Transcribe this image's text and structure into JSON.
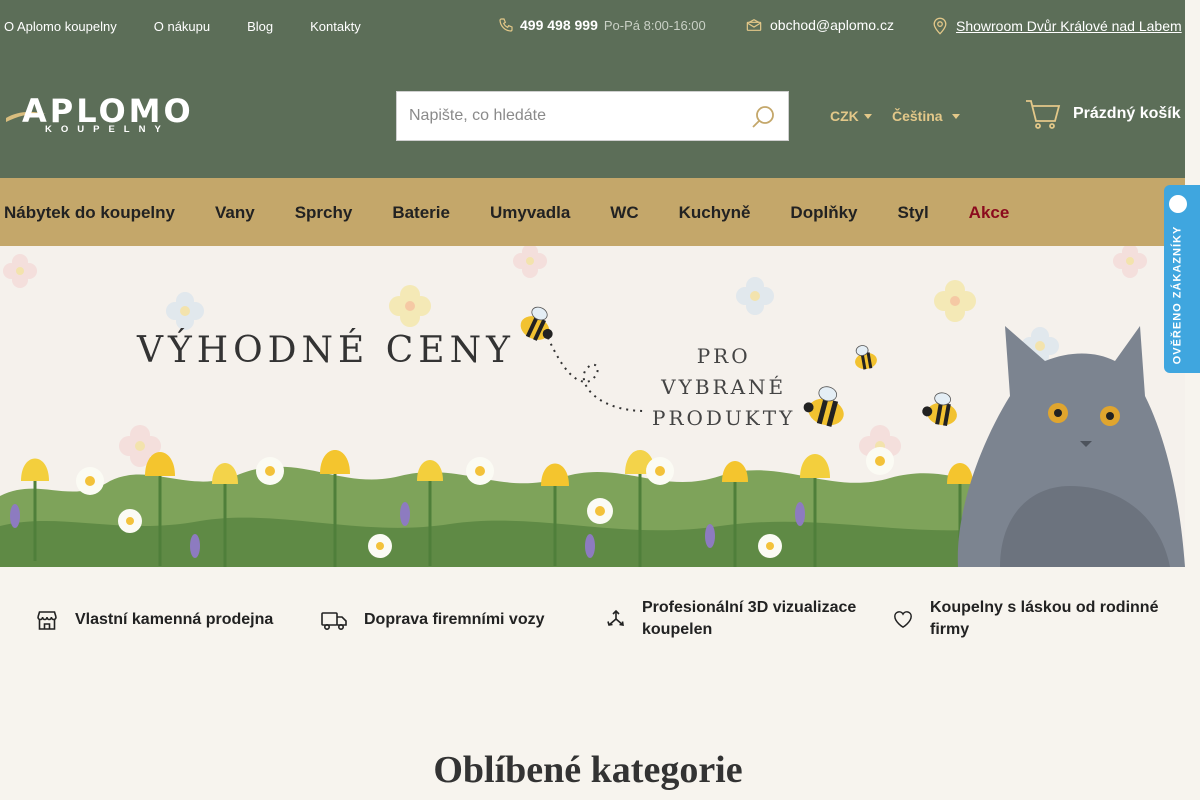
{
  "topbar": {
    "links": [
      "O Aplomo koupelny",
      "O nákupu",
      "Blog",
      "Kontakty"
    ],
    "phone": "499 498 999",
    "hours": "Po-Pá 8:00-16:00",
    "email": "obchod@aplomo.cz",
    "showroom": "Showroom Dvůr Králové nad Labem",
    "misc_glyph": ""
  },
  "logo": {
    "name": "APLOMO",
    "subtitle": "KOUPELNY"
  },
  "search": {
    "placeholder": "Napište, co hledáte",
    "value": ""
  },
  "currency": "CZK",
  "language": "Čeština",
  "user_glyph": "",
  "cart": {
    "label": "Prázdný košík"
  },
  "nav": [
    "Nábytek do koupelny",
    "Vany",
    "Sprchy",
    "Baterie",
    "Umyvadla",
    "WC",
    "Kuchyně",
    "Doplňky",
    "Styl",
    "Akce"
  ],
  "banner": {
    "title": "VÝHODNÉ CENY",
    "subtitle_lines": [
      "PRO",
      "VYBRANÉ",
      "PRODUKTY"
    ]
  },
  "side_badge": {
    "label": "OVĚŘENO ZÁKAZNÍKY"
  },
  "features": [
    {
      "icon": "store-icon",
      "text": "Vlastní kamenná prodejna"
    },
    {
      "icon": "truck-icon",
      "text": "Doprava firemními vozy"
    },
    {
      "icon": "3d-icon",
      "text": "Profesionální 3D vizualizace koupelen"
    },
    {
      "icon": "heart-icon",
      "text": "Koupelny s láskou od rodinné firmy"
    }
  ],
  "section_title": "Oblíbené kategorie",
  "colors": {
    "header_bg": "#5c6e58",
    "nav_bg": "#c4a76a",
    "accent_gold": "#e3c889",
    "sale_red": "#8b0a1d",
    "badge_blue": "#3fa6df",
    "page_bg": "#f7f4ee"
  }
}
